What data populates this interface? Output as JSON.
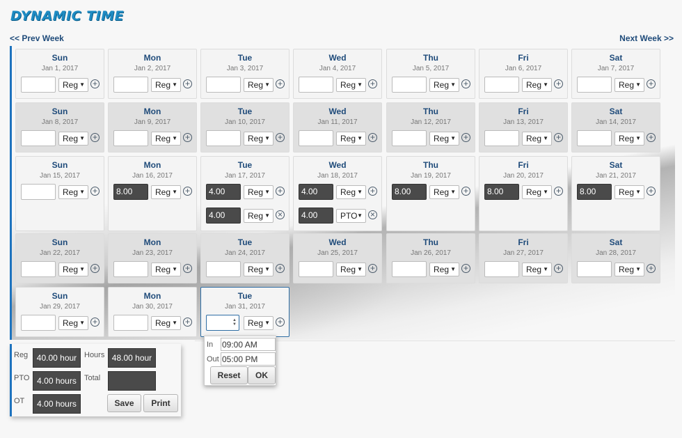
{
  "app": {
    "title": "DYNAMIC TIME"
  },
  "nav": {
    "prev": "<< Prev Week",
    "next": "Next Week >>"
  },
  "days": [
    {
      "day": "Sun",
      "date": "Jan 1, 2017",
      "entries": [
        {
          "hours": "",
          "type": "Reg",
          "action": "add"
        }
      ]
    },
    {
      "day": "Mon",
      "date": "Jan 2, 2017",
      "entries": [
        {
          "hours": "",
          "type": "Reg",
          "action": "add"
        }
      ]
    },
    {
      "day": "Tue",
      "date": "Jan 3, 2017",
      "entries": [
        {
          "hours": "",
          "type": "Reg",
          "action": "add"
        }
      ]
    },
    {
      "day": "Wed",
      "date": "Jan 4, 2017",
      "entries": [
        {
          "hours": "",
          "type": "Reg",
          "action": "add"
        }
      ]
    },
    {
      "day": "Thu",
      "date": "Jan 5, 2017",
      "entries": [
        {
          "hours": "",
          "type": "Reg",
          "action": "add"
        }
      ]
    },
    {
      "day": "Fri",
      "date": "Jan 6, 2017",
      "entries": [
        {
          "hours": "",
          "type": "Reg",
          "action": "add"
        }
      ]
    },
    {
      "day": "Sat",
      "date": "Jan 7, 2017",
      "entries": [
        {
          "hours": "",
          "type": "Reg",
          "action": "add"
        }
      ]
    },
    {
      "day": "Sun",
      "date": "Jan 8, 2017",
      "entries": [
        {
          "hours": "",
          "type": "Reg",
          "action": "add"
        }
      ]
    },
    {
      "day": "Mon",
      "date": "Jan 9, 2017",
      "entries": [
        {
          "hours": "",
          "type": "Reg",
          "action": "add"
        }
      ]
    },
    {
      "day": "Tue",
      "date": "Jan 10, 2017",
      "entries": [
        {
          "hours": "",
          "type": "Reg",
          "action": "add"
        }
      ]
    },
    {
      "day": "Wed",
      "date": "Jan 11, 2017",
      "entries": [
        {
          "hours": "",
          "type": "Reg",
          "action": "add"
        }
      ]
    },
    {
      "day": "Thu",
      "date": "Jan 12, 2017",
      "entries": [
        {
          "hours": "",
          "type": "Reg",
          "action": "add"
        }
      ]
    },
    {
      "day": "Fri",
      "date": "Jan 13, 2017",
      "entries": [
        {
          "hours": "",
          "type": "Reg",
          "action": "add"
        }
      ]
    },
    {
      "day": "Sat",
      "date": "Jan 14, 2017",
      "entries": [
        {
          "hours": "",
          "type": "Reg",
          "action": "add"
        }
      ]
    },
    {
      "day": "Sun",
      "date": "Jan 15, 2017",
      "entries": [
        {
          "hours": "",
          "type": "Reg",
          "action": "add"
        }
      ]
    },
    {
      "day": "Mon",
      "date": "Jan 16, 2017",
      "entries": [
        {
          "hours": "8.00",
          "type": "Reg",
          "action": "add"
        }
      ]
    },
    {
      "day": "Tue",
      "date": "Jan 17, 2017",
      "entries": [
        {
          "hours": "4.00",
          "type": "Reg",
          "action": "add"
        },
        {
          "hours": "4.00",
          "type": "Reg",
          "action": "remove"
        }
      ]
    },
    {
      "day": "Wed",
      "date": "Jan 18, 2017",
      "entries": [
        {
          "hours": "4.00",
          "type": "Reg",
          "action": "add"
        },
        {
          "hours": "4.00",
          "type": "PTO",
          "action": "remove"
        }
      ]
    },
    {
      "day": "Thu",
      "date": "Jan 19, 2017",
      "entries": [
        {
          "hours": "8.00",
          "type": "Reg",
          "action": "add"
        }
      ]
    },
    {
      "day": "Fri",
      "date": "Jan 20, 2017",
      "entries": [
        {
          "hours": "8.00",
          "type": "Reg",
          "action": "add"
        }
      ]
    },
    {
      "day": "Sat",
      "date": "Jan 21, 2017",
      "entries": [
        {
          "hours": "8.00",
          "type": "Reg",
          "action": "add"
        }
      ]
    },
    {
      "day": "Sun",
      "date": "Jan 22, 2017",
      "entries": [
        {
          "hours": "",
          "type": "Reg",
          "action": "add"
        }
      ]
    },
    {
      "day": "Mon",
      "date": "Jan 23, 2017",
      "entries": [
        {
          "hours": "",
          "type": "Reg",
          "action": "add"
        }
      ]
    },
    {
      "day": "Tue",
      "date": "Jan 24, 2017",
      "entries": [
        {
          "hours": "",
          "type": "Reg",
          "action": "add"
        }
      ]
    },
    {
      "day": "Wed",
      "date": "Jan 25, 2017",
      "entries": [
        {
          "hours": "",
          "type": "Reg",
          "action": "add"
        }
      ]
    },
    {
      "day": "Thu",
      "date": "Jan 26, 2017",
      "entries": [
        {
          "hours": "",
          "type": "Reg",
          "action": "add"
        }
      ]
    },
    {
      "day": "Fri",
      "date": "Jan 27, 2017",
      "entries": [
        {
          "hours": "",
          "type": "Reg",
          "action": "add"
        }
      ]
    },
    {
      "day": "Sat",
      "date": "Jan 28, 2017",
      "entries": [
        {
          "hours": "",
          "type": "Reg",
          "action": "add"
        }
      ]
    },
    {
      "day": "Sun",
      "date": "Jan 29, 2017",
      "entries": [
        {
          "hours": "",
          "type": "Reg",
          "action": "add"
        }
      ]
    },
    {
      "day": "Mon",
      "date": "Jan 30, 2017",
      "entries": [
        {
          "hours": "",
          "type": "Reg",
          "action": "add"
        }
      ]
    },
    {
      "day": "Tue",
      "date": "Jan 31, 2017",
      "entries": [
        {
          "hours": "",
          "type": "Reg",
          "action": "add"
        }
      ]
    }
  ],
  "time_popup": {
    "in_label": "In",
    "in_value": "09:00 AM",
    "out_label": "Out",
    "out_value": "05:00 PM",
    "reset": "Reset",
    "ok": "OK"
  },
  "totals": {
    "reg_label": "Reg",
    "reg_value": "40.00 hour",
    "pto_label": "PTO",
    "pto_value": "4.00 hours",
    "ot_label": "OT",
    "ot_value": "4.00 hours",
    "hours_label": "Hours",
    "hours_value": "48.00 hour",
    "total_label": "Total",
    "total_value": "",
    "save": "Save",
    "print": "Print"
  }
}
